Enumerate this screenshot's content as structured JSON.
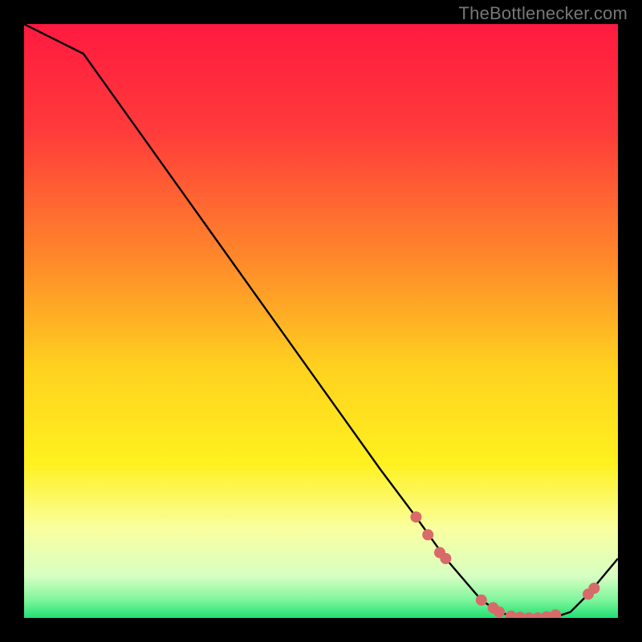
{
  "attribution": "TheBottlenecker.com",
  "chart_data": {
    "type": "line",
    "title": "",
    "xlabel": "",
    "ylabel": "",
    "xlim": [
      0,
      100
    ],
    "ylim": [
      0,
      100
    ],
    "series": [
      {
        "name": "curve",
        "x": [
          0,
          6,
          10,
          20,
          30,
          40,
          50,
          60,
          66,
          71,
          77,
          80,
          83,
          86,
          89,
          92,
          95,
          100
        ],
        "values": [
          100,
          97,
          95,
          81,
          67,
          53,
          39,
          25,
          17,
          10,
          3,
          1,
          0,
          0,
          0,
          1,
          4,
          10
        ]
      }
    ],
    "markers": [
      {
        "x": 66,
        "y": 17
      },
      {
        "x": 68,
        "y": 14
      },
      {
        "x": 70,
        "y": 11
      },
      {
        "x": 71,
        "y": 10
      },
      {
        "x": 77,
        "y": 3
      },
      {
        "x": 79,
        "y": 1.7
      },
      {
        "x": 80,
        "y": 1
      },
      {
        "x": 82,
        "y": 0.3
      },
      {
        "x": 83.5,
        "y": 0.1
      },
      {
        "x": 85,
        "y": 0
      },
      {
        "x": 86.5,
        "y": 0
      },
      {
        "x": 88,
        "y": 0.2
      },
      {
        "x": 89.5,
        "y": 0.5
      },
      {
        "x": 95,
        "y": 4
      },
      {
        "x": 96,
        "y": 5
      }
    ],
    "background_gradient": {
      "stops": [
        {
          "offset": 0.0,
          "color": "#ff1a40"
        },
        {
          "offset": 0.18,
          "color": "#ff3b3b"
        },
        {
          "offset": 0.4,
          "color": "#ff8a2a"
        },
        {
          "offset": 0.58,
          "color": "#ffd21f"
        },
        {
          "offset": 0.74,
          "color": "#fff11f"
        },
        {
          "offset": 0.85,
          "color": "#faffa0"
        },
        {
          "offset": 0.93,
          "color": "#d6ffc2"
        },
        {
          "offset": 0.97,
          "color": "#7ef59c"
        },
        {
          "offset": 1.0,
          "color": "#20e072"
        }
      ]
    },
    "marker_color": "#d86a6a",
    "line_color": "#000000"
  }
}
